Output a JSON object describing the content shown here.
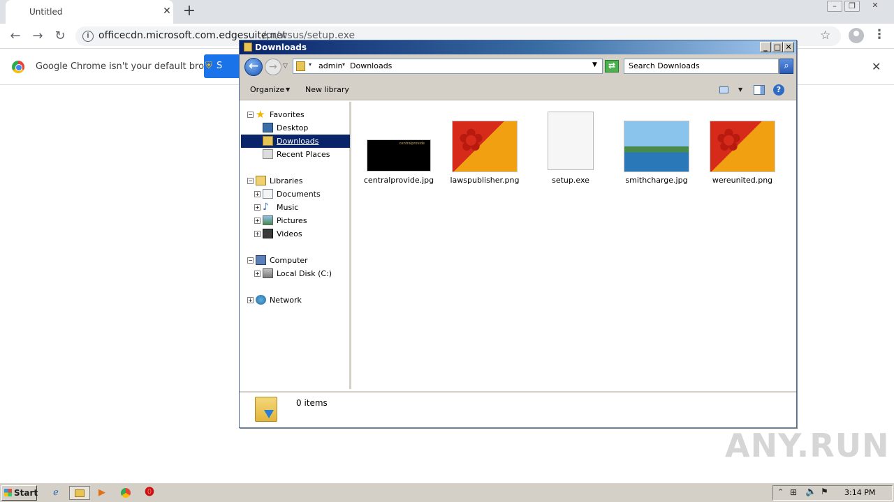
{
  "browser": {
    "tab_title": "Untitled",
    "tab_close": "✕",
    "new_tab": "+",
    "url_host": "officecdn.microsoft.com.edgesuite.net",
    "url_path": "/pr/wsus/setup.exe",
    "infobar_text": "Google Chrome isn't your default browser",
    "infobar_button": "S"
  },
  "explorer": {
    "title": "Downloads",
    "breadcrumb": [
      "admin",
      "Downloads"
    ],
    "search_placeholder": "Search Downloads",
    "toolbar": {
      "organize": "Organize",
      "new_library": "New library"
    },
    "nav": {
      "favorites": "Favorites",
      "desktop": "Desktop",
      "downloads": "Downloads",
      "recent": "Recent Places",
      "libraries": "Libraries",
      "documents": "Documents",
      "music": "Music",
      "pictures": "Pictures",
      "videos": "Videos",
      "computer": "Computer",
      "local_disk": "Local Disk (C:)",
      "network": "Network"
    },
    "files": [
      {
        "name": "centralprovide.jpg",
        "thumb_text": "centralprovide"
      },
      {
        "name": "lawspublisher.png"
      },
      {
        "name": "setup.exe"
      },
      {
        "name": "smithcharge.jpg"
      },
      {
        "name": "wereunited.png"
      }
    ],
    "status": "0 items"
  },
  "taskbar": {
    "start": "Start",
    "clock": "3:14 PM"
  },
  "watermark": "ANY.RUN"
}
